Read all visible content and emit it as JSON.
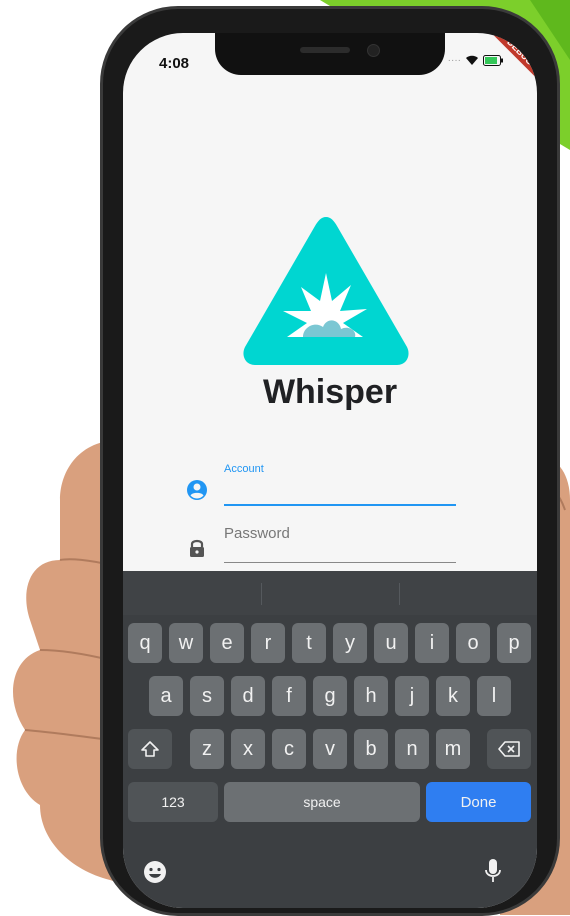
{
  "status_bar": {
    "time": "4:08",
    "debug_banner": "DEBUG"
  },
  "app": {
    "title": "Whisper"
  },
  "form": {
    "account": {
      "label": "Account"
    },
    "password": {
      "placeholder": "Password"
    }
  },
  "keyboard": {
    "row1": [
      "q",
      "w",
      "e",
      "r",
      "t",
      "y",
      "u",
      "i",
      "o",
      "p"
    ],
    "row2": [
      "a",
      "s",
      "d",
      "f",
      "g",
      "h",
      "j",
      "k",
      "l"
    ],
    "row3": [
      "z",
      "x",
      "c",
      "v",
      "b",
      "n",
      "m"
    ],
    "numbers_key": "123",
    "space_key": "space",
    "done_key": "Done"
  },
  "colors": {
    "accent": "#2196F3",
    "logo": "#00D6D1",
    "done": "#2F7EF1"
  }
}
